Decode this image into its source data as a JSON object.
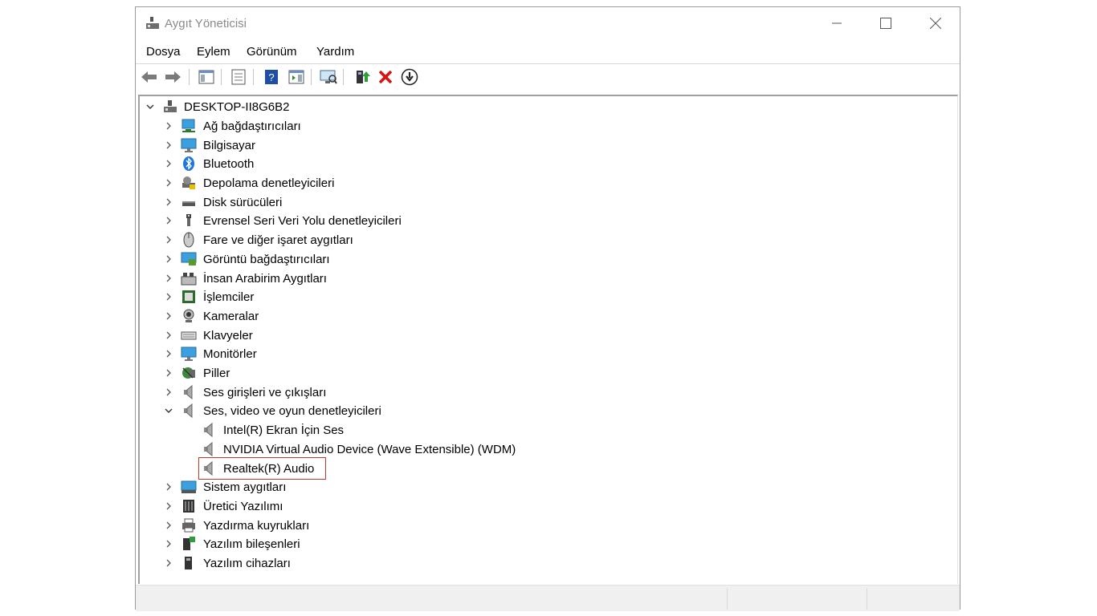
{
  "window": {
    "title": "Aygıt Yöneticisi",
    "controls": {
      "minimize": "minimize-icon",
      "maximize": "maximize-icon",
      "close": "close-icon"
    }
  },
  "menu": [
    {
      "label": "Dosya"
    },
    {
      "label": "Eylem"
    },
    {
      "label": "Görünüm"
    },
    {
      "label": "Yardım"
    }
  ],
  "toolbar": [
    {
      "icon": "back-arrow-icon"
    },
    {
      "icon": "forward-arrow-icon"
    },
    {
      "icon": "show-hide-console-tree-icon"
    },
    {
      "icon": "properties-icon"
    },
    {
      "icon": "help-icon"
    },
    {
      "icon": "show-action-pane-icon"
    },
    {
      "icon": "scan-hardware-icon"
    },
    {
      "icon": "update-driver-icon"
    },
    {
      "icon": "uninstall-device-icon"
    },
    {
      "icon": "disable-device-icon"
    }
  ],
  "tree": {
    "root": "DESKTOP-II8G6B2",
    "categories": [
      {
        "label": "Ağ bağdaştırıcıları",
        "icon": "network-adapter-icon"
      },
      {
        "label": "Bilgisayar",
        "icon": "computer-icon"
      },
      {
        "label": "Bluetooth",
        "icon": "bluetooth-icon"
      },
      {
        "label": "Depolama denetleyicileri",
        "icon": "storage-controller-icon"
      },
      {
        "label": "Disk sürücüleri",
        "icon": "disk-drive-icon"
      },
      {
        "label": "Evrensel Seri Veri Yolu denetleyicileri",
        "icon": "usb-icon"
      },
      {
        "label": "Fare ve diğer işaret aygıtları",
        "icon": "mouse-icon"
      },
      {
        "label": "Görüntü bağdaştırıcıları",
        "icon": "display-adapter-icon"
      },
      {
        "label": "İnsan Arabirim Aygıtları",
        "icon": "hid-icon"
      },
      {
        "label": "İşlemciler",
        "icon": "processor-icon"
      },
      {
        "label": "Kameralar",
        "icon": "camera-icon"
      },
      {
        "label": "Klavyeler",
        "icon": "keyboard-icon"
      },
      {
        "label": "Monitörler",
        "icon": "monitor-icon"
      },
      {
        "label": "Piller",
        "icon": "battery-icon"
      },
      {
        "label": "Ses girişleri ve çıkışları",
        "icon": "speaker-icon"
      },
      {
        "label": "Ses, video ve oyun denetleyicileri",
        "icon": "speaker-icon",
        "expanded": true,
        "children": [
          {
            "label": "Intel(R) Ekran İçin Ses",
            "icon": "speaker-icon"
          },
          {
            "label": "NVIDIA Virtual Audio Device (Wave Extensible) (WDM)",
            "icon": "speaker-icon"
          },
          {
            "label": "Realtek(R) Audio",
            "icon": "speaker-icon",
            "highlighted": true
          }
        ]
      },
      {
        "label": "Sistem aygıtları",
        "icon": "system-device-icon"
      },
      {
        "label": "Üretici Yazılımı",
        "icon": "firmware-icon"
      },
      {
        "label": "Yazdırma kuyrukları",
        "icon": "printer-icon"
      },
      {
        "label": "Yazılım bileşenleri",
        "icon": "software-component-icon"
      },
      {
        "label": "Yazılım cihazları",
        "icon": "software-device-icon"
      }
    ]
  },
  "colors": {
    "accent": "#0078d7",
    "highlight_border": "#c0392b"
  }
}
